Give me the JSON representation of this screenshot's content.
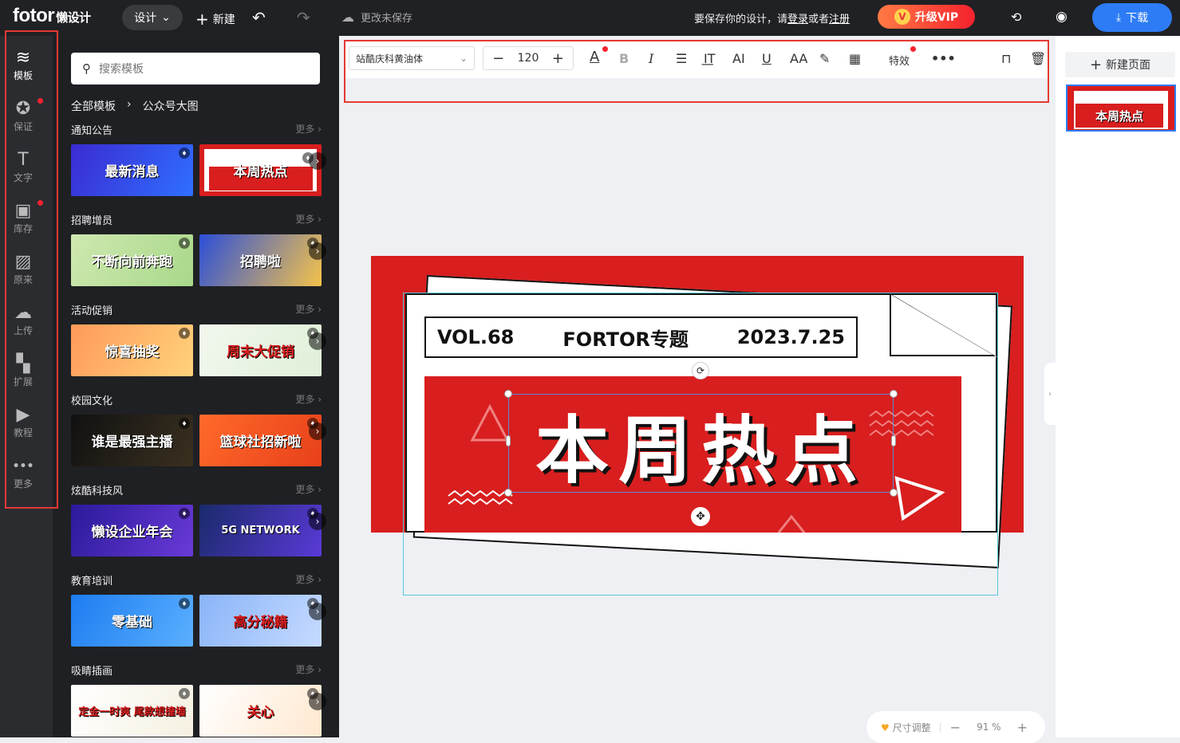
{
  "topbar": {
    "logo": "fotor",
    "logo_sub": "懒设计",
    "design_menu": "设计",
    "new_label": "新建",
    "save_status": "更改未保存",
    "save_hint_pre": "要保存你的设计，请",
    "login": "登录",
    "or": "或者",
    "register": "注册",
    "vip_label": "升级VIP",
    "download_label": "下载"
  },
  "sidenav": [
    {
      "label": "模板",
      "icon": "layers-icon",
      "active": true
    },
    {
      "label": "保证",
      "icon": "badge-icon",
      "dot": true
    },
    {
      "label": "文字",
      "icon": "text-icon"
    },
    {
      "label": "库存",
      "icon": "image-icon",
      "dot": true
    },
    {
      "label": "原来",
      "icon": "pattern-icon"
    },
    {
      "label": "上传",
      "icon": "upload-icon"
    },
    {
      "label": "扩展",
      "icon": "extension-icon"
    },
    {
      "label": "教程",
      "icon": "play-icon"
    },
    {
      "label": "更多",
      "icon": "more-icon"
    }
  ],
  "panel": {
    "search_placeholder": "搜索模板",
    "crumb_all": "全部模板",
    "crumb_current": "公众号大图",
    "more_label": "更多",
    "sections": [
      {
        "title": "通知公告",
        "t1": "最新消息",
        "t2": "本周热点"
      },
      {
        "title": "招聘增员",
        "t1": "不断向前奔跑",
        "t2": "招聘啦"
      },
      {
        "title": "活动促销",
        "t1": "惊喜抽奖",
        "t2": "周末大促销"
      },
      {
        "title": "校园文化",
        "t1": "谁是最强主播",
        "t2": "篮球社招新啦"
      },
      {
        "title": "炫酷科技风",
        "t1": "懒设企业年会",
        "t2": "5G NETWORK"
      },
      {
        "title": "教育培训",
        "t1": "零基础",
        "t2": "高分秘籍"
      },
      {
        "title": "吸睛插画",
        "t1": "定金一时爽 尾款想撞墙",
        "t2": "关心"
      }
    ]
  },
  "toolbar": {
    "font_name": "站酷庆科黄油体",
    "font_size": "120",
    "effects": "特效"
  },
  "canvas": {
    "vol": "VOL.68",
    "topic": "FORTOR专题",
    "date": "2023.7.25",
    "headline": "本周热点"
  },
  "rightpanel": {
    "new_page": "新建页面",
    "thumb_text": "本周热点"
  },
  "zoom": {
    "resize_label": "尺寸调整",
    "zoom_level": "91 %"
  }
}
